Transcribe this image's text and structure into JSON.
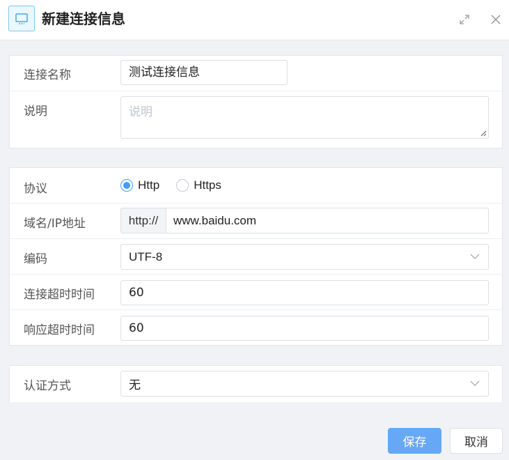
{
  "dialog": {
    "title": "新建连接信息",
    "header_icon": "monitor-icon",
    "maximize_icon": "maximize-icon",
    "close_icon": "close-icon"
  },
  "basic": {
    "name_label": "连接名称",
    "name_value": "测试连接信息",
    "desc_label": "说明",
    "desc_placeholder": "说明"
  },
  "connection": {
    "protocol_label": "协议",
    "protocol_options": [
      "Http",
      "Https"
    ],
    "protocol_selected": "Http",
    "host_label": "域名/IP地址",
    "host_prefix": "http://",
    "host_value": "www.baidu.com",
    "encoding_label": "编码",
    "encoding_value": "UTF-8",
    "connect_timeout_label": "连接超时时间",
    "connect_timeout_value": "60",
    "response_timeout_label": "响应超时时间",
    "response_timeout_value": "60"
  },
  "auth": {
    "method_label": "认证方式",
    "method_value": "无"
  },
  "footer": {
    "save_label": "保存",
    "cancel_label": "取消"
  },
  "colors": {
    "primary": "#409eff",
    "save_button": "#66a8f5",
    "header_icon_border": "#7fc8ea"
  }
}
